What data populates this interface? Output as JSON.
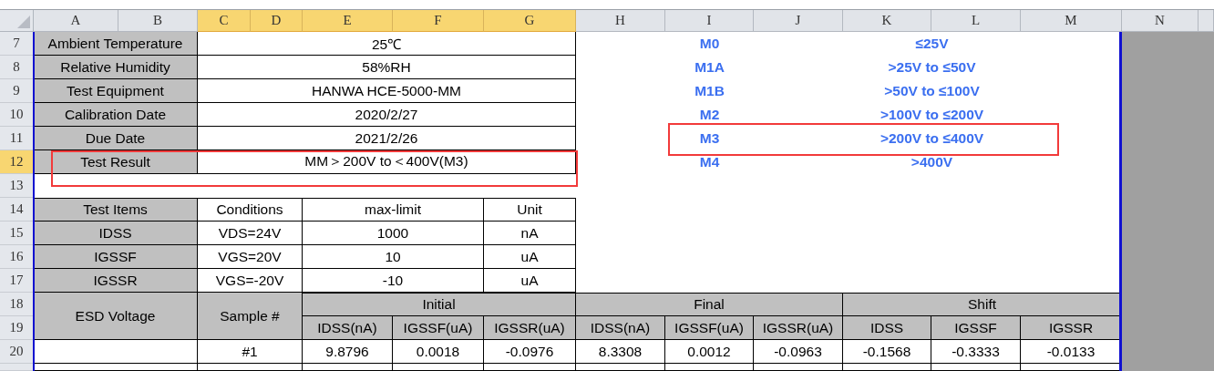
{
  "column_headers": [
    {
      "label": "A",
      "selected": false
    },
    {
      "label": "B",
      "selected": false
    },
    {
      "label": "C",
      "selected": true
    },
    {
      "label": "D",
      "selected": true
    },
    {
      "label": "E",
      "selected": true
    },
    {
      "label": "F",
      "selected": true
    },
    {
      "label": "G",
      "selected": true
    },
    {
      "label": "H",
      "selected": false
    },
    {
      "label": "I",
      "selected": false
    },
    {
      "label": "J",
      "selected": false
    },
    {
      "label": "K",
      "selected": false
    },
    {
      "label": "L",
      "selected": false
    },
    {
      "label": "M",
      "selected": false
    },
    {
      "label": "N",
      "selected": false
    }
  ],
  "row_headers": [
    {
      "label": "7",
      "selected": false
    },
    {
      "label": "8",
      "selected": false
    },
    {
      "label": "9",
      "selected": false
    },
    {
      "label": "10",
      "selected": false
    },
    {
      "label": "11",
      "selected": false
    },
    {
      "label": "12",
      "selected": true
    },
    {
      "label": "13",
      "selected": false
    },
    {
      "label": "14",
      "selected": false
    },
    {
      "label": "15",
      "selected": false
    },
    {
      "label": "16",
      "selected": false
    },
    {
      "label": "17",
      "selected": false
    },
    {
      "label": "18",
      "selected": false
    },
    {
      "label": "19",
      "selected": false
    },
    {
      "label": "20",
      "selected": false
    }
  ],
  "conditions": [
    {
      "label": "Ambient Temperature",
      "value": "25℃",
      "highlighted": false
    },
    {
      "label": "Relative Humidity",
      "value": "58%RH",
      "highlighted": false
    },
    {
      "label": "Test Equipment",
      "value": "HANWA HCE-5000-MM",
      "highlighted": false
    },
    {
      "label": "Calibration Date",
      "value": "2020/2/27",
      "highlighted": false
    },
    {
      "label": "Due Date",
      "value": "2021/2/26",
      "highlighted": false
    },
    {
      "label": "Test Result",
      "value": "MM＞200V to＜400V(M3)",
      "highlighted": true
    }
  ],
  "voltage_classes": [
    {
      "class": "M0",
      "range": "≤25V",
      "highlighted": false
    },
    {
      "class": "M1A",
      "range": ">25V to ≤50V",
      "highlighted": false
    },
    {
      "class": "M1B",
      "range": ">50V to ≤100V",
      "highlighted": false
    },
    {
      "class": "M2",
      "range": ">100V to ≤200V",
      "highlighted": false
    },
    {
      "class": "M3",
      "range": ">200V to ≤400V",
      "highlighted": true
    },
    {
      "class": "M4",
      "range": ">400V",
      "highlighted": false
    }
  ],
  "test_items": {
    "columns": [
      "Test Items",
      "Conditions",
      "max-limit",
      "Unit"
    ],
    "rows": [
      [
        "IDSS",
        "VDS=24V",
        "1000",
        "nA"
      ],
      [
        "IGSSF",
        "VGS=20V",
        "10",
        "uA"
      ],
      [
        "IGSSR",
        "VGS=-20V",
        "-10",
        "uA"
      ]
    ]
  },
  "esd_table": {
    "esd_voltage": "ESD Voltage",
    "sample": "Sample #",
    "groups": [
      {
        "name": "Initial",
        "columns": [
          "IDSS(nA)",
          "IGSSF(uA)",
          "IGSSR(uA)"
        ]
      },
      {
        "name": "Final",
        "columns": [
          "IDSS(nA)",
          "IGSSF(uA)",
          "IGSSR(uA)"
        ]
      },
      {
        "name": "Shift",
        "columns": [
          "IDSS",
          "IGSSF",
          "IGSSR"
        ]
      }
    ],
    "rows": [
      {
        "sample": "#1",
        "values": [
          "9.8796",
          "0.0018",
          "-0.0976",
          "8.3308",
          "0.0012",
          "-0.0963",
          "-0.1568",
          "-0.3333",
          "-0.0133"
        ]
      }
    ]
  }
}
